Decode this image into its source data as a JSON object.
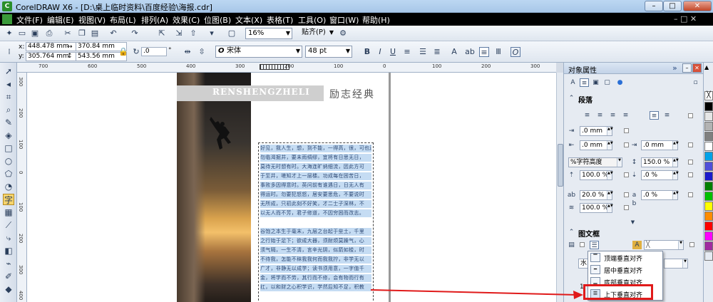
{
  "titlebar": {
    "logo": "C",
    "title": "CorelDRAW X6 - [D:\\桌上临时资料\\百度经验\\海报.cdr]",
    "min": "–",
    "max": "□",
    "close": "✕"
  },
  "menu": [
    "文件(F)",
    "编辑(E)",
    "视图(V)",
    "布局(L)",
    "排列(A)",
    "效果(C)",
    "位图(B)",
    "文本(X)",
    "表格(T)",
    "工具(O)",
    "窗口(W)",
    "帮助(H)"
  ],
  "toolbar1": {
    "zoom": "16%",
    "snap": "贴齐(P)"
  },
  "toolbar2": {
    "x_label": "x:",
    "x": "448.478 mm",
    "y_label": "y:",
    "y": "305.764 mm",
    "w": "370.84 mm",
    "h": "543.56 mm",
    "angle": ".0",
    "degree": "°",
    "font": "宋体",
    "size": "48 pt"
  },
  "ruler": {
    "h": [
      "700",
      "600",
      "500",
      "400",
      "300",
      "200",
      "100",
      "0",
      "100",
      "200",
      "300"
    ],
    "v": [
      "300",
      "200",
      "100",
      "0",
      "100",
      "200",
      "300",
      "400"
    ]
  },
  "poster": {
    "banner": "RENSHENGZHELI",
    "heading": "励志经典",
    "lines": [
      "好见，我人生，想，到不能，一得高，很，可也还，去为了什么",
      "勿临渴掘井，要未雨绸缪，宜将有日思无日，",
      "莫待无时想有时。大海连旷纳细流，因此方可",
      "于至井，嗟知才上一层楼。功成每在困苦日，",
      "事败多因得意时。英问前有谁遇日，日无人有",
      "得运时。勿要犯怒怒，居安要思危，不要说时",
      "无所成，只初此刻不好笑，才二士子深林，不",
      "以无人而不芳，君子修道，不因穷困而改志。",
      "",
      "谷饱之本生于毫末，九层之台起于垒土，千里",
      "之行始于足下；欲成大器，须耐烦莫躁气，心",
      "须气隔，一生不清，言辛光阴，似箭如梭，时",
      "不待我，怎能不秣我我何而我我拧，非学无以",
      "广才，非静无以成学；读书须用意，一字值千",
      "金，将学而不劳，其行而不修，会有物而行有",
      "扛，以和财之心积学识，学然后知不足，积教"
    ]
  },
  "docker": {
    "title": "对象属性",
    "expand": "»",
    "paragraph": "段落",
    "fields": {
      "indent_first": ".0 mm",
      "indent_left": ".0 mm",
      "indent_right": ".0 mm",
      "spacing_unit": "%字符高度",
      "line_spacing": "150.0 %",
      "before": "100.0 %",
      "after": ".0 %",
      "char_spacing": "20.0 %",
      "word_spacing": ".0 %",
      "lang_spacing": "100.0 %"
    },
    "frame": "图文框",
    "frame_combo": "水",
    "frame_num": "1"
  },
  "popup": [
    "顶端垂直对齐",
    "居中垂直对齐",
    "底部垂直对齐",
    "上下垂直对齐"
  ],
  "colors": {
    "accent": "#e01a1a",
    "menubar": "#000000",
    "text_highlight": "#c5dcf3"
  },
  "palette": [
    "#ffffff",
    "#000000",
    "#e6e6e6",
    "#b3b3b3",
    "#808080",
    "#ffffff",
    "#00a2e8",
    "#4f4fd9",
    "#1a1acc",
    "#008000",
    "#00c000",
    "#ffff00",
    "#ff8c00",
    "#ff0000",
    "#ff00ff",
    "#a02ba0"
  ]
}
